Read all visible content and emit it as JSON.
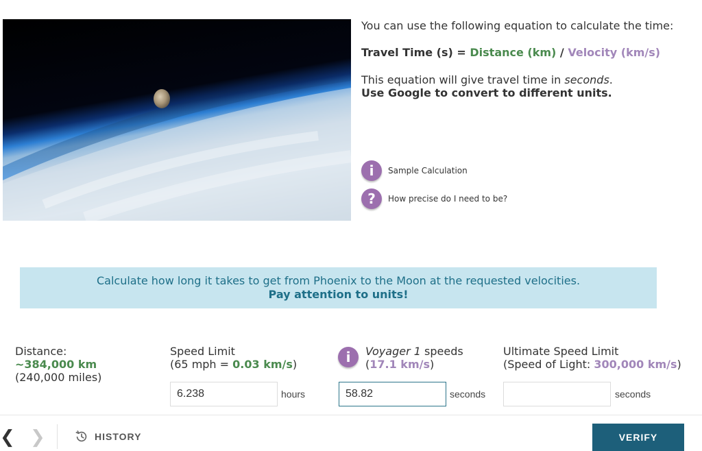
{
  "hero": {
    "icon": "earth-moon-photo"
  },
  "info": {
    "intro": "You can use the following equation to calculate the time:",
    "equation": {
      "lhs": "Travel Time (s) = ",
      "distance": "Distance (km)",
      "op": " / ",
      "velocity": "Velocity (km/s)"
    },
    "note_pre": "This equation will give travel time in ",
    "note_em": "seconds",
    "note_post": ".",
    "note_bold": "Use Google to convert to different units.",
    "links": [
      {
        "icon": "i",
        "label": "Sample Calculation"
      },
      {
        "icon": "?",
        "label": "How precise do I need to be?"
      }
    ]
  },
  "banner": {
    "line1": "Calculate how long it takes to get from Phoenix to the Moon at the requested velocities.",
    "line2": "Pay attention to units!"
  },
  "columns": {
    "distance": {
      "label": "Distance:",
      "value": "~384,000 km",
      "alt": "(240,000 miles)"
    },
    "speed_limit": {
      "title": "Speed Limit",
      "pre": "(65 mph = ",
      "value": "0.03 km/s",
      "post": ")",
      "input": "6.238",
      "unit": "hours"
    },
    "voyager": {
      "title_em": "Voyager 1",
      "title_rest": " speeds",
      "pre": "(",
      "value": "17.1 km/s",
      "post": ")",
      "input": "58.82",
      "unit": "seconds",
      "icon": "i"
    },
    "light": {
      "title": "Ultimate Speed Limit",
      "pre": "(Speed of Light: ",
      "value": "300,000 km/s",
      "post": ")",
      "input": "",
      "unit": "seconds"
    }
  },
  "footer": {
    "prev": "❮",
    "next": "❯",
    "history": "HISTORY",
    "verify": "VERIFY"
  },
  "colors": {
    "accent_purple": "#9c6fae",
    "distance_green": "#4a8a4e",
    "velocity_purple": "#a186b9",
    "banner_bg": "#c7e5ef",
    "verify_bg": "#1d5f7a"
  }
}
